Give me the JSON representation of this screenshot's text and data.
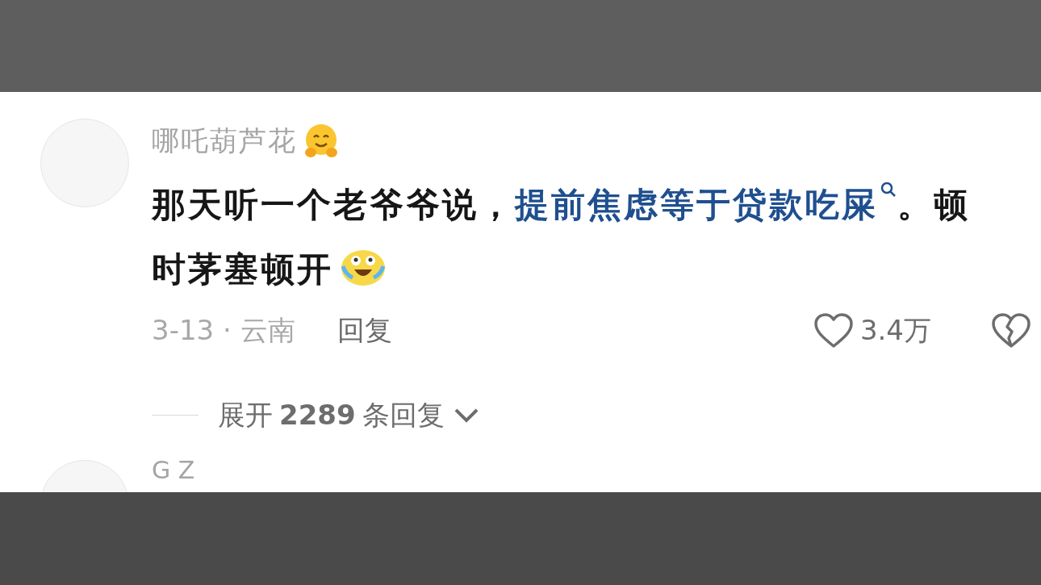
{
  "comment": {
    "author": "哪吒葫芦花",
    "text_before": "那天听一个老爷爷说，",
    "link": "提前焦虑等于贷款吃屎",
    "text_after": "。顿时茅塞顿开",
    "date_location": "3-13 · 云南",
    "reply": "回复",
    "likes": "3.4万",
    "expand": {
      "label": "展开",
      "count": "2289",
      "suffix": "条回复"
    }
  },
  "next_comment": {
    "author": "G Z"
  }
}
